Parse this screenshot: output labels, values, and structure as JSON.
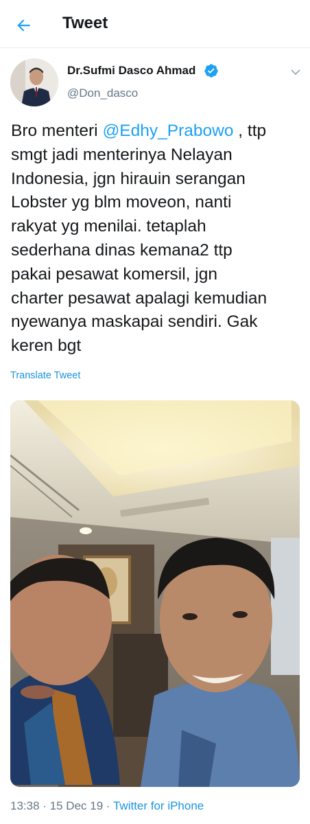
{
  "header": {
    "title": "Tweet",
    "back_icon": "arrow-left-icon",
    "accent": "#1da1f2"
  },
  "author": {
    "name": "Dr.Sufmi Dasco Ahmad",
    "handle": "@Don_dasco",
    "verified": true,
    "verified_icon": "verified-badge-icon",
    "menu_icon": "chevron-down-icon"
  },
  "tweet": {
    "lines": [
      {
        "before": "Bro menteri ",
        "mention": "@Edhy_Prabowo",
        "after": " , ttp"
      },
      {
        "text": "smgt jadi menterinya Nelayan"
      },
      {
        "text": "Indonesia, jgn hirauin serangan"
      },
      {
        "text": "Lobster yg blm moveon, nanti"
      },
      {
        "text": "rakyat yg menilai. tetaplah"
      },
      {
        "text": "sederhana dinas kemana2 ttp"
      },
      {
        "text": "pakai pesawat komersil, jgn"
      },
      {
        "text": "charter pesawat apalagi kemudian"
      },
      {
        "text": "nyewanya maskapai sendiri. Gak"
      },
      {
        "text": "keren bgt"
      }
    ],
    "translate_label": "Translate Tweet"
  },
  "meta": {
    "time": "13:38",
    "sep1": " · ",
    "date": "15 Dec 19",
    "sep2": " · ",
    "source": "Twitter for iPhone"
  },
  "colors": {
    "text": "#14171a",
    "secondary": "#657786",
    "link": "#1b95e0",
    "divider": "#e6ecf0"
  }
}
